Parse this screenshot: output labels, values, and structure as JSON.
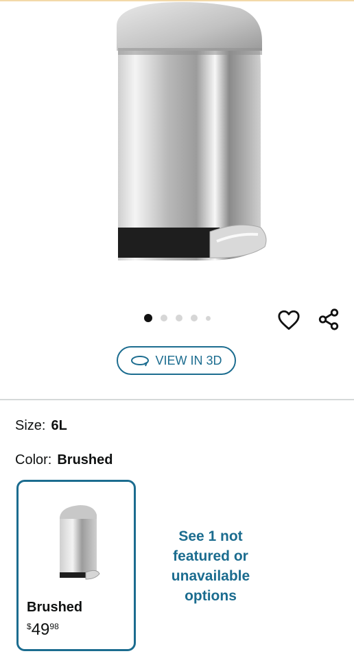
{
  "product": {
    "image_alt": "stainless steel step trash can",
    "carousel": {
      "count": 5,
      "active_index": 0
    }
  },
  "actions": {
    "view_3d_label": "VIEW IN 3D",
    "wishlist_icon": "heart-icon",
    "share_icon": "share-icon"
  },
  "size": {
    "label": "Size:",
    "value": "6L"
  },
  "color": {
    "label": "Color:",
    "value": "Brushed"
  },
  "options": [
    {
      "name": "Brushed",
      "price_currency": "$",
      "price_whole": "49",
      "price_fraction": "98"
    }
  ],
  "more_options_text": "See 1 not featured or unavailable options",
  "colors": {
    "accent": "#1b6c8f",
    "text": "#0f1111",
    "divider": "#d5d9d9"
  }
}
